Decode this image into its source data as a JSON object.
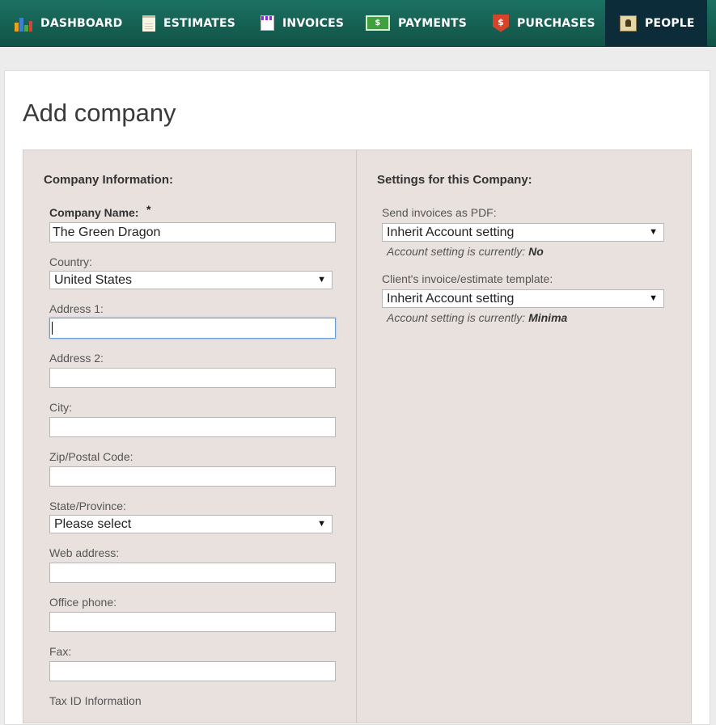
{
  "nav": {
    "items": [
      {
        "label": "DASHBOARD",
        "icon": "dashboard-icon"
      },
      {
        "label": "ESTIMATES",
        "icon": "estimates-icon"
      },
      {
        "label": "INVOICES",
        "icon": "invoices-icon"
      },
      {
        "label": "PAYMENTS",
        "icon": "payments-icon"
      },
      {
        "label": "PURCHASES",
        "icon": "purchases-icon"
      },
      {
        "label": "PEOPLE",
        "icon": "people-icon",
        "active": true
      }
    ],
    "payments_icon_text": "$",
    "purchases_icon_text": "$"
  },
  "page": {
    "title": "Add company"
  },
  "company_info": {
    "heading": "Company Information:",
    "company_name_label": "Company Name:",
    "required_mark": "*",
    "company_name_value": "The Green Dragon",
    "country_label": "Country:",
    "country_value": "United States",
    "address1_label": "Address 1:",
    "address1_value": "",
    "address2_label": "Address 2:",
    "address2_value": "",
    "city_label": "City:",
    "city_value": "",
    "zip_label": "Zip/Postal Code:",
    "zip_value": "",
    "state_label": "State/Province:",
    "state_value": "Please select",
    "web_label": "Web address:",
    "web_value": "",
    "phone_label": "Office phone:",
    "phone_value": "",
    "fax_label": "Fax:",
    "fax_value": "",
    "tax_label": "Tax ID Information"
  },
  "settings": {
    "heading": "Settings for this Company:",
    "pdf_label": "Send invoices as PDF:",
    "pdf_value": "Inherit Account setting",
    "pdf_note_prefix": "Account setting is currently: ",
    "pdf_note_value": "No",
    "template_label": "Client's invoice/estimate template:",
    "template_value": "Inherit Account setting",
    "template_note_prefix": "Account setting is currently: ",
    "template_note_value": "Minima"
  },
  "colors": {
    "nav_bg": "#166256",
    "nav_active": "#0d2c3a",
    "form_bg": "#e8e1de"
  }
}
